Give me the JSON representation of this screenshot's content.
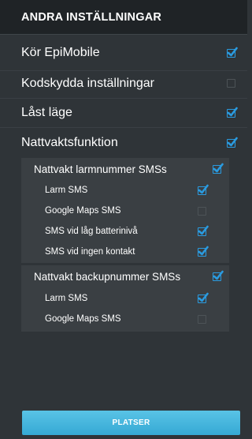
{
  "header": {
    "title": "ANDRA INSTÄLLNINGAR"
  },
  "settings": {
    "kor_epimobile": {
      "label": "Kör EpiMobile",
      "checked": true
    },
    "kodskydda": {
      "label": "Kodskydda inställningar",
      "checked": false
    },
    "last_lage": {
      "label": "Låst läge",
      "checked": true
    },
    "nattvaktsfunktion": {
      "label": "Nattvaktsfunktion",
      "checked": true
    }
  },
  "larmnummer": {
    "label": "Nattvakt larmnummer SMSs",
    "checked": true,
    "items": [
      {
        "label": "Larm SMS",
        "checked": true
      },
      {
        "label": "Google Maps SMS",
        "checked": false
      },
      {
        "label": "SMS vid låg batterinivå",
        "checked": true
      },
      {
        "label": "SMS vid ingen kontakt",
        "checked": true
      }
    ]
  },
  "backupnummer": {
    "label": "Nattvakt backupnummer SMSs",
    "checked": true,
    "items": [
      {
        "label": "Larm SMS",
        "checked": true
      },
      {
        "label": "Google Maps SMS",
        "checked": false
      }
    ]
  },
  "footer": {
    "button_label": "PLATSER"
  },
  "colors": {
    "accent": "#2a9be0",
    "button": "#45b5dd",
    "background": "#2f3438",
    "header": "#1f2326"
  }
}
